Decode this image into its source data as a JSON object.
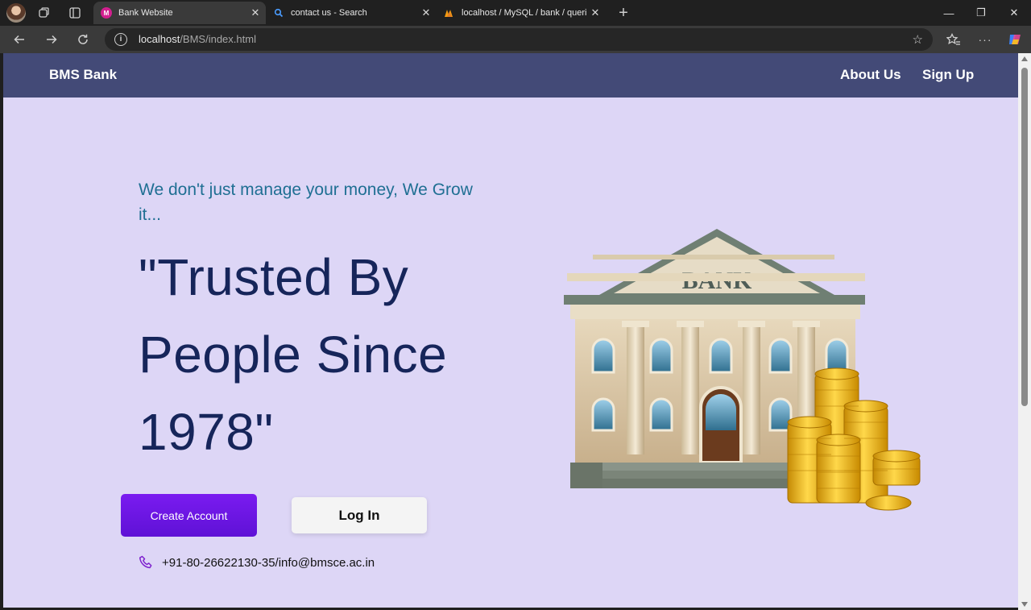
{
  "browser": {
    "tabs": [
      {
        "title": "Bank Website",
        "active": true,
        "icon": "bank-site-favicon"
      },
      {
        "title": "contact us - Search",
        "active": false,
        "icon": "search-favicon"
      },
      {
        "title": "localhost / MySQL / bank / queri",
        "active": false,
        "icon": "phpmyadmin-favicon"
      }
    ],
    "new_tab_label": "+",
    "address": {
      "host": "localhost",
      "path": "/BMS/index.html"
    },
    "window_controls": {
      "minimize": "—",
      "restore": "❐",
      "close": "✕"
    }
  },
  "site": {
    "brand": "BMS Bank",
    "nav": {
      "about": "About Us",
      "signup": "Sign Up"
    },
    "tagline": "We don't just manage your money, We Grow it...",
    "headline": "\"Trusted By People Since 1978\"",
    "buttons": {
      "create": "Create Account",
      "login": "Log In"
    },
    "contact": "+91-80-26622130-35/info@bmsce.ac.in",
    "bank_sign": "BANK"
  },
  "colors": {
    "page_bg": "#ddd6f6",
    "header_bg": "#434a77",
    "tagline": "#1f6f93",
    "headline": "#16255a",
    "create_button": "#6a16e2"
  }
}
